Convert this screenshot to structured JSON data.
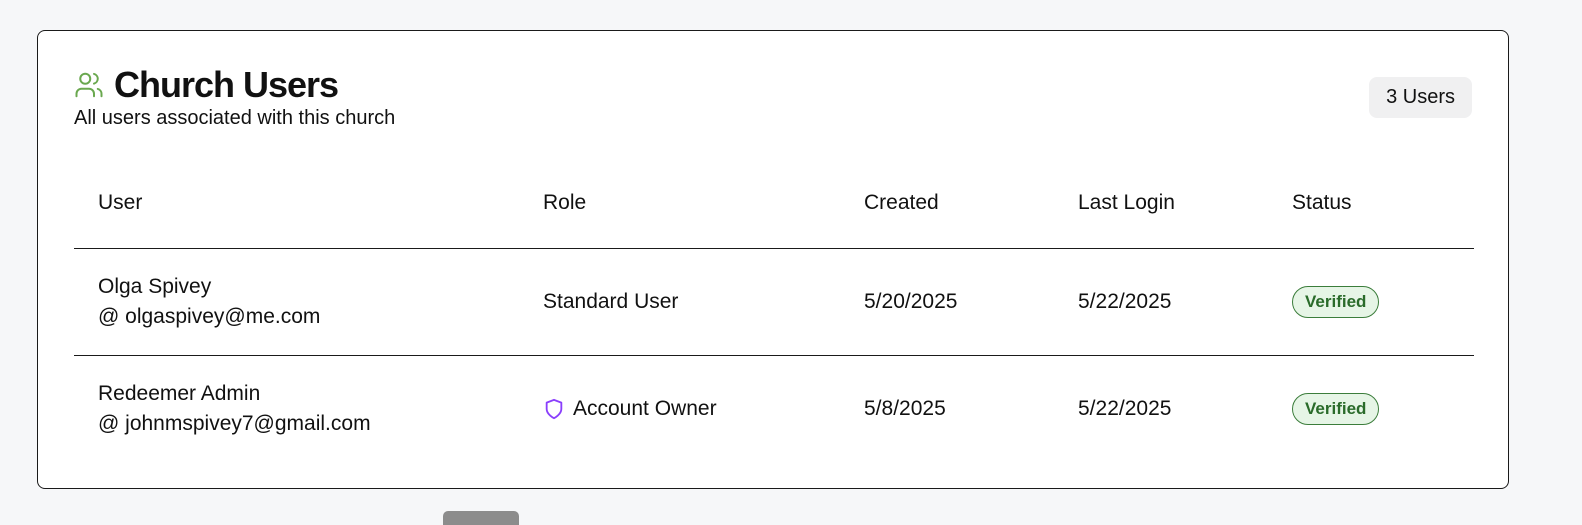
{
  "card": {
    "title": "Church Users",
    "subtitle": "All users associated with this church",
    "count_label": "3 Users",
    "icon": "users-icon"
  },
  "table": {
    "headers": [
      "User",
      "Role",
      "Created",
      "Last Login",
      "Status"
    ],
    "rows": [
      {
        "name": "Olga Spivey",
        "email": "@ olgaspivey@me.com",
        "role": "Standard User",
        "role_icon": null,
        "created": "5/20/2025",
        "last_login": "5/22/2025",
        "status": "Verified"
      },
      {
        "name": "Redeemer Admin",
        "email": "@ johnmspivey7@gmail.com",
        "role": "Account Owner",
        "role_icon": "shield-icon",
        "created": "5/8/2025",
        "last_login": "5/22/2025",
        "status": "Verified"
      }
    ]
  },
  "colors": {
    "accent_green": "#6aa84f",
    "verified_bg": "#e6f5e6",
    "verified_text": "#2a6b2a",
    "shield_purple": "#8a3ffc"
  }
}
